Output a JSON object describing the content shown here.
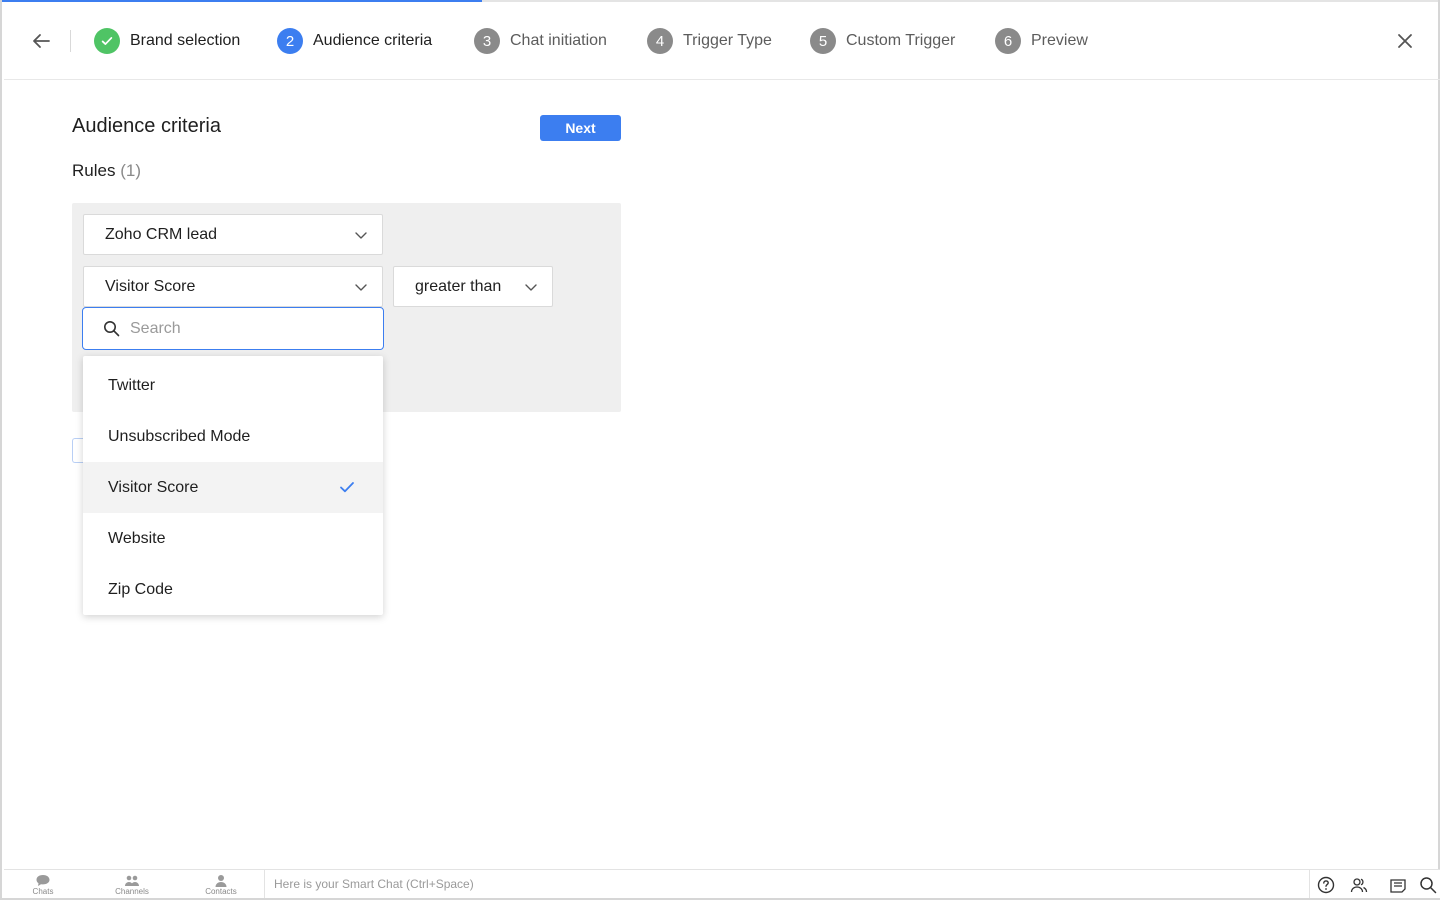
{
  "steps": [
    {
      "number": "",
      "label": "Brand selection",
      "state": "done"
    },
    {
      "number": "2",
      "label": "Audience criteria",
      "state": "active"
    },
    {
      "number": "3",
      "label": "Chat initiation",
      "state": "pending"
    },
    {
      "number": "4",
      "label": "Trigger Type",
      "state": "pending"
    },
    {
      "number": "5",
      "label": "Custom Trigger",
      "state": "pending"
    },
    {
      "number": "6",
      "label": "Preview",
      "state": "pending"
    }
  ],
  "main": {
    "title": "Audience criteria",
    "next_label": "Next",
    "rules_label": "Rules",
    "rules_count": "(1)"
  },
  "rule": {
    "source": "Zoho CRM lead",
    "field": "Visitor Score",
    "operator": "greater than"
  },
  "search": {
    "placeholder": "Search",
    "value": ""
  },
  "dropdown": {
    "items": [
      "Twitter",
      "Unsubscribed Mode",
      "Visitor Score",
      "Website",
      "Zip Code"
    ],
    "selected": "Visitor Score"
  },
  "bottombar": {
    "nav": [
      "Chats",
      "Channels",
      "Contacts"
    ],
    "smart_chat_placeholder": "Here is your Smart Chat (Ctrl+Space)"
  },
  "colors": {
    "accent": "#3c7ef0",
    "done": "#4fc465",
    "pending": "#8a8a8a"
  }
}
